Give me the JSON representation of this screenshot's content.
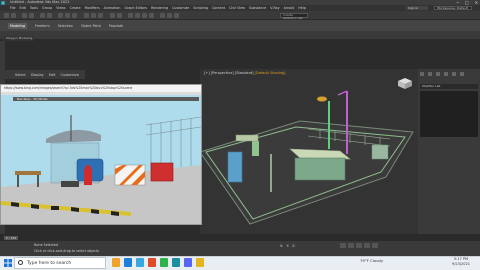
{
  "window": {
    "title": "Untitled - Autodesk 3ds Max 2022"
  },
  "menu": [
    "File",
    "Edit",
    "Tools",
    "Group",
    "Views",
    "Create",
    "Modifiers",
    "Animation",
    "Graph Editors",
    "Rendering",
    "Customize",
    "Scripting",
    "Content",
    "Civil View",
    "Substance",
    "V-Ray",
    "Arnold",
    "Help"
  ],
  "sign_in_label": "Sign In",
  "workspace": "Workspaces: Default",
  "selection_set_placeholder": "Create Selection Set",
  "ribbon": {
    "tabs": [
      "Modeling",
      "Freeform",
      "Selection",
      "Object Paint",
      "Populate"
    ],
    "polygon_modeling": "Polygon Modeling"
  },
  "scene_explorer": {
    "tabs": [
      "Select",
      "Display",
      "Edit",
      "Customize"
    ]
  },
  "viewport": {
    "label_parts": [
      "[+] [Perspective] [Standard] ",
      "[Default Shading]"
    ]
  },
  "command_panel": {
    "modifier_list": "Modifier List"
  },
  "browser": {
    "address": "https://www.bing.com/images/search?q=3ds%20max%20bus%20stop%20scene",
    "inner_header": "Bus Stop - 3D Model"
  },
  "timeline": {
    "slider": "0 / 100"
  },
  "status": {
    "line1": "None Selected",
    "line2": "Click or click-and-drag to select objects"
  },
  "coords": {
    "x_label": "X:",
    "y_label": "Y:",
    "z_label": "Z:"
  },
  "taskbar": {
    "search_placeholder": "Type here to search",
    "tray_temp": "79°F Cloudy",
    "time": "5:17 PM",
    "date": "9/23/2021"
  }
}
